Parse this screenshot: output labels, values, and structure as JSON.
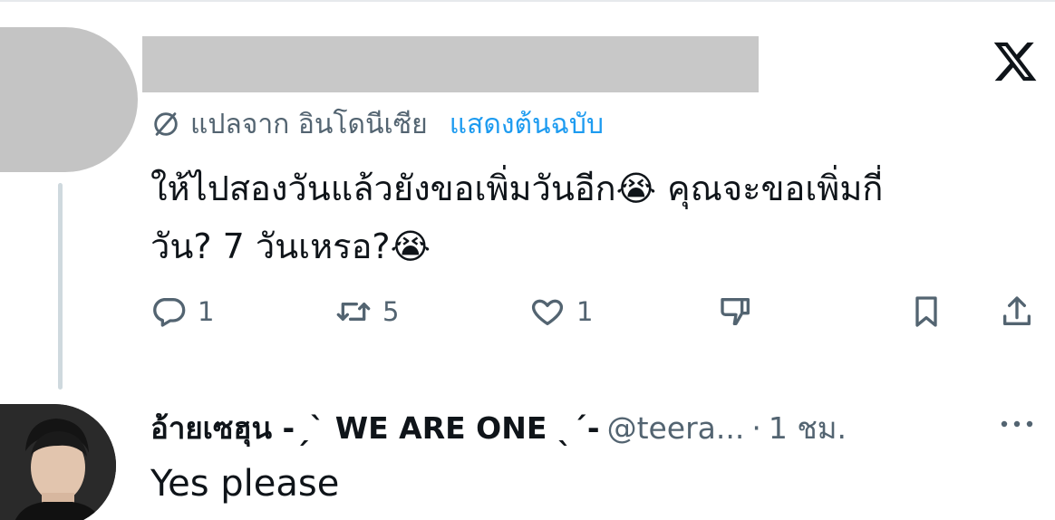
{
  "tweet1": {
    "translate": {
      "label": "แปลจาก อินโดนีเซีย",
      "show_original": "แสดงต้นฉบับ"
    },
    "text_line1": "ให้ไปสองวันแล้วยังขอเพิ่มวันอีก😭 คุณจะขอเพิ่มกี่",
    "text_line2": "วัน? 7 วันเหรอ?😭",
    "actions": {
      "replies": "1",
      "reposts": "5",
      "likes": "1"
    }
  },
  "tweet2": {
    "display_name": "อ้ายเซฮุน -ˏˋ WE ARE ONE ˎˊ-",
    "handle": "@teera...",
    "separator": "·",
    "time": "1 ชม.",
    "text": "Yes please"
  },
  "icons": {
    "x_logo": "x-logo-icon",
    "translate": "translate-icon",
    "reply": "reply-icon",
    "repost": "repost-icon",
    "like": "heart-icon",
    "dislike": "thumbs-down-icon",
    "bookmark": "bookmark-icon",
    "share": "share-icon",
    "more": "more-dots-icon"
  },
  "colors": {
    "accent": "#1d9bf0",
    "muted": "#536471",
    "text": "#0f1419"
  }
}
